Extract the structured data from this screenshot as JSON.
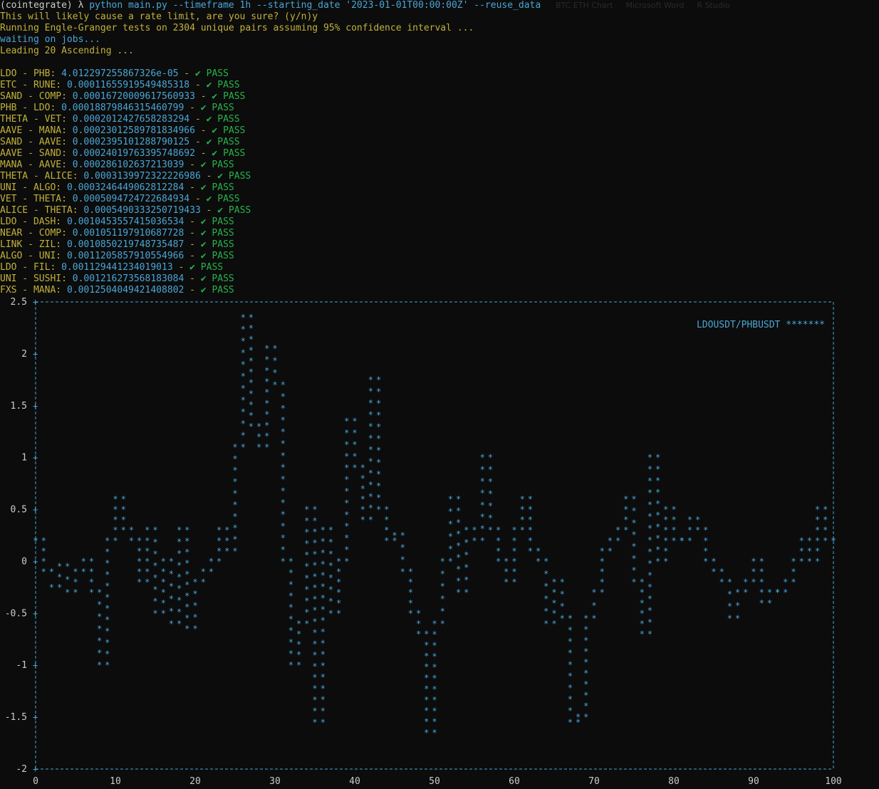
{
  "prompt": {
    "env": "(cointegrate)",
    "symbol": "λ",
    "command": "python main.py --timeframe 1h --starting_date '2023-01-01T00:00:00Z' --reuse_data"
  },
  "background_tabs": [
    "BTC ETH Chart",
    "Microsoft Word",
    "R Studio"
  ],
  "confirm_line": "This will likely cause a rate limit, are you sure? (y/n)y",
  "running_line": "Running Engle-Granger tests on 2304 unique pairs assuming 95% confidence interval ...",
  "waiting_line": "waiting on jobs...",
  "leading_line": "Leading 20 Ascending ...",
  "pass_label": "PASS",
  "results": [
    {
      "pair": "LDO - PHB",
      "value": "4.012297255867326e-05"
    },
    {
      "pair": "ETC - RUNE",
      "value": "0.00011655919549485318"
    },
    {
      "pair": "SAND - COMP",
      "value": "0.00016720009617560933"
    },
    {
      "pair": "PHB - LDO",
      "value": "0.00018879846315460799"
    },
    {
      "pair": "THETA - VET",
      "value": "0.0002012427658283294"
    },
    {
      "pair": "AAVE - MANA",
      "value": "0.00023012589781834966"
    },
    {
      "pair": "SAND - AAVE",
      "value": "0.0002395101288790125"
    },
    {
      "pair": "AAVE - SAND",
      "value": "0.00024019763395748692"
    },
    {
      "pair": "MANA - AAVE",
      "value": "0.000286102637213039"
    },
    {
      "pair": "THETA - ALICE",
      "value": "0.0003139972322226986"
    },
    {
      "pair": "UNI - ALGO",
      "value": "0.0003246449062812284"
    },
    {
      "pair": "VET - THETA",
      "value": "0.0005094724722684934"
    },
    {
      "pair": "ALICE - THETA",
      "value": "0.0005490333250719433"
    },
    {
      "pair": "LDO - DASH",
      "value": "0.0010453557415036534"
    },
    {
      "pair": "NEAR - COMP",
      "value": "0.001051197910687728"
    },
    {
      "pair": "LINK - ZIL",
      "value": "0.0010850219748735487"
    },
    {
      "pair": "ALGO - UNI",
      "value": "0.0011205857910554966"
    },
    {
      "pair": "LDO - FIL",
      "value": "0.001129441234019013"
    },
    {
      "pair": "UNI - SUSHI",
      "value": "0.001216273568183084"
    },
    {
      "pair": "FXS - MANA",
      "value": "0.0012504049421408802"
    }
  ],
  "chart_data": {
    "type": "scatter",
    "legend": "LDOUSDT/PHBUSDT *******",
    "legend_placement": "top-right",
    "marker": "*",
    "xlim": [
      0,
      100
    ],
    "ylim": [
      -2,
      2.5
    ],
    "x_ticks": [
      0,
      10,
      20,
      30,
      40,
      50,
      60,
      70,
      80,
      90,
      100
    ],
    "y_ticks": [
      2.5,
      2,
      1.5,
      1,
      0.5,
      0,
      -0.5,
      -1,
      -1.5,
      -2
    ],
    "y_tick_labels": [
      "2.5",
      "2",
      "1.5",
      "1",
      "0.5",
      "0",
      "-0.5",
      "-1",
      "-1.5",
      "-2"
    ],
    "grid": false,
    "color": "#4aa6d6",
    "series": [
      {
        "x": [
          0,
          1,
          2,
          3,
          4,
          5,
          6,
          7,
          8,
          9,
          10,
          11,
          12,
          13,
          14,
          15,
          16,
          17,
          18,
          19,
          20,
          21,
          22,
          23,
          24,
          25,
          26,
          27,
          28,
          29,
          30,
          31,
          32,
          33,
          34,
          35,
          36,
          37,
          38,
          39,
          40,
          41,
          42,
          43,
          44,
          45,
          46,
          47,
          48,
          49,
          50,
          51,
          52,
          53,
          54,
          55,
          56,
          57,
          58,
          59,
          60,
          61,
          62,
          63,
          64,
          65,
          66,
          67,
          68,
          69,
          70,
          71,
          72,
          73,
          74,
          75,
          76,
          77,
          78,
          79,
          80,
          81,
          82,
          83,
          84,
          85,
          86,
          87,
          88,
          89,
          90,
          91,
          92,
          93,
          94,
          95,
          96,
          97,
          98,
          99,
          100
        ],
        "y": [
          0.2,
          -0.1,
          -0.25,
          -0.05,
          -0.3,
          -0.1,
          0.0,
          -0.3,
          -1.0,
          0.2,
          0.6,
          0.3,
          0.2,
          -0.2,
          0.3,
          -0.5,
          0.0,
          -0.6,
          0.3,
          -0.65,
          -0.2,
          -0.1,
          0.0,
          0.3,
          0.1,
          1.1,
          2.35,
          1.3,
          1.1,
          2.05,
          1.7,
          0.0,
          -1.0,
          -0.6,
          0.5,
          -1.55,
          0.3,
          -0.5,
          0.0,
          1.35,
          0.9,
          0.4,
          1.75,
          0.5,
          0.2,
          0.25,
          -0.1,
          -0.5,
          -0.7,
          -1.65,
          -0.6,
          0.0,
          0.6,
          -0.3,
          0.3,
          0.2,
          1.0,
          0.3,
          0.0,
          -0.2,
          0.3,
          0.6,
          0.1,
          0.0,
          -0.6,
          -0.2,
          -0.55,
          -1.55,
          -1.5,
          -0.55,
          -0.3,
          0.1,
          0.2,
          0.3,
          0.6,
          -0.2,
          -0.7,
          1.0,
          0.0,
          0.5,
          0.2,
          0.2,
          0.4,
          0.3,
          0.0,
          -0.1,
          -0.2,
          -0.55,
          -0.3,
          -0.2,
          0.0,
          -0.4,
          -0.3,
          -0.3,
          -0.2,
          0.0,
          0.2,
          0.0,
          0.5,
          0.2,
          0.2
        ]
      }
    ]
  }
}
